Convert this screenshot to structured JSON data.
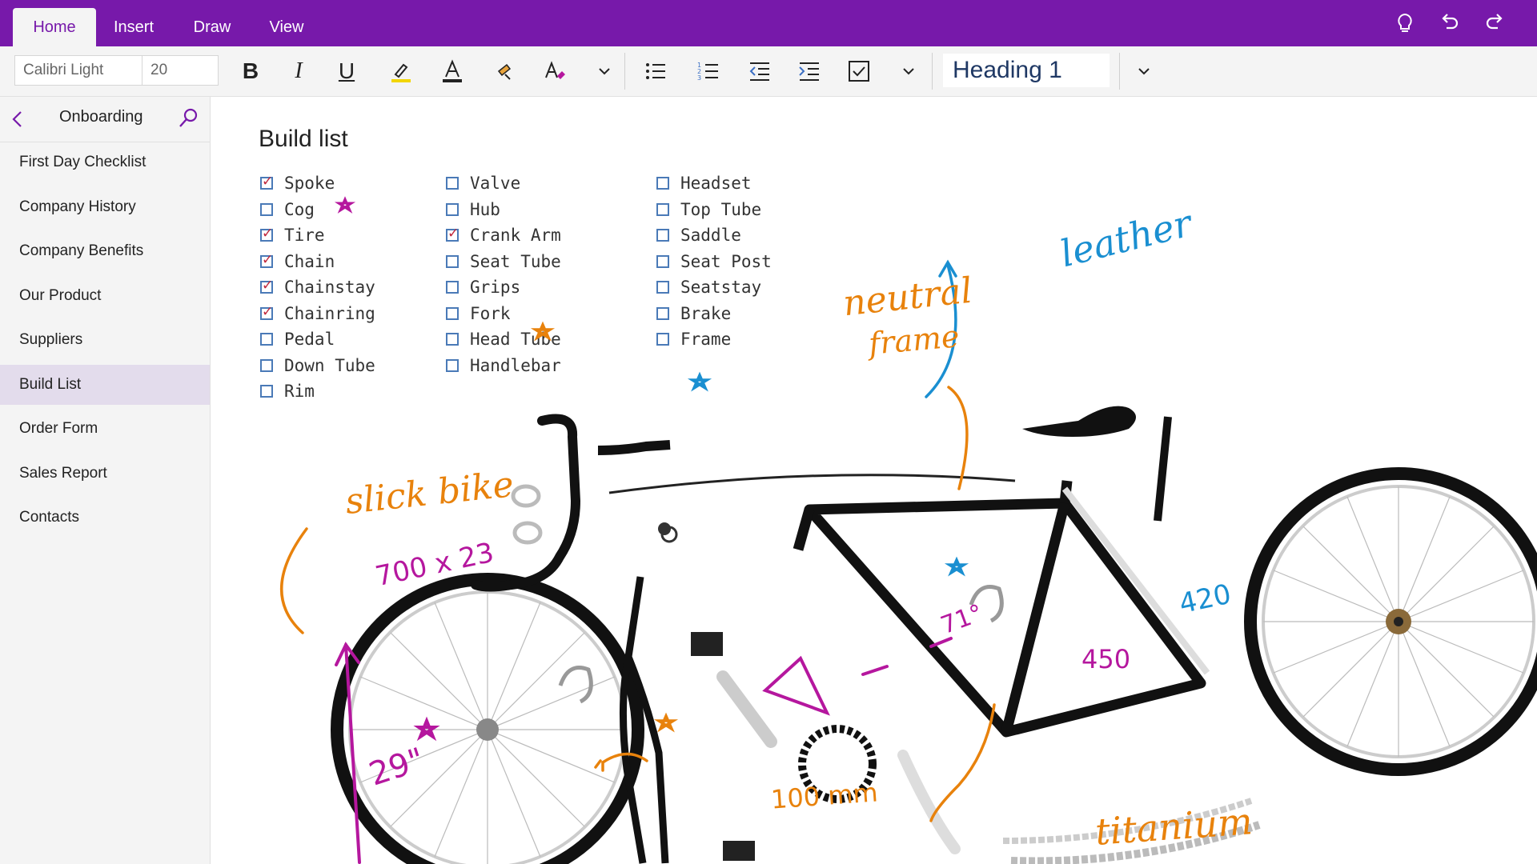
{
  "tabs": [
    {
      "label": "Home",
      "active": true
    },
    {
      "label": "Insert",
      "active": false
    },
    {
      "label": "Draw",
      "active": false
    },
    {
      "label": "View",
      "active": false
    }
  ],
  "title_icons": [
    "lightbulb-icon",
    "undo-icon",
    "redo-icon"
  ],
  "ribbon": {
    "font_name": "Calibri Light",
    "font_size": "20",
    "style": "Heading 1",
    "buttons": [
      "bold",
      "italic",
      "underline",
      "highlight",
      "font-color",
      "format-painter",
      "clear-formatting",
      "more",
      "bullets",
      "numbering",
      "outdent",
      "indent",
      "todo-tag",
      "more",
      "styles-dropdown"
    ]
  },
  "sidebar": {
    "section": "Onboarding",
    "pages": [
      {
        "label": "First Day Checklist",
        "selected": false
      },
      {
        "label": "Company History",
        "selected": false
      },
      {
        "label": "Company Benefits",
        "selected": false
      },
      {
        "label": "Our Product",
        "selected": false
      },
      {
        "label": "Suppliers",
        "selected": false
      },
      {
        "label": "Build List",
        "selected": true
      },
      {
        "label": "Order Form",
        "selected": false
      },
      {
        "label": "Sales Report",
        "selected": false
      },
      {
        "label": "Contacts",
        "selected": false
      }
    ]
  },
  "page": {
    "title": "Build list",
    "columns": [
      [
        {
          "label": "Spoke",
          "checked": true
        },
        {
          "label": "Cog",
          "checked": false
        },
        {
          "label": "Tire",
          "checked": true
        },
        {
          "label": "Chain",
          "checked": true
        },
        {
          "label": "Chainstay",
          "checked": true
        },
        {
          "label": "Chainring",
          "checked": true
        },
        {
          "label": "Pedal",
          "checked": false
        },
        {
          "label": "Down Tube",
          "checked": false
        },
        {
          "label": "Rim",
          "checked": false
        }
      ],
      [
        {
          "label": "Valve",
          "checked": false
        },
        {
          "label": "Hub",
          "checked": false
        },
        {
          "label": "Crank Arm",
          "checked": true
        },
        {
          "label": "Seat Tube",
          "checked": false
        },
        {
          "label": "Grips",
          "checked": false
        },
        {
          "label": "Fork",
          "checked": false
        },
        {
          "label": "Head Tube",
          "checked": false
        },
        {
          "label": "Handlebar",
          "checked": false
        }
      ],
      [
        {
          "label": "Headset",
          "checked": false
        },
        {
          "label": "Top Tube",
          "checked": false
        },
        {
          "label": "Saddle",
          "checked": false
        },
        {
          "label": "Seat Post",
          "checked": false
        },
        {
          "label": "Seatstay",
          "checked": false
        },
        {
          "label": "Brake",
          "checked": false
        },
        {
          "label": "Frame",
          "checked": false
        }
      ]
    ],
    "ink": {
      "slick_bike": "slick bike",
      "tire_size": "700 x 23",
      "wheel_size": "29\"",
      "neutral": "neutral",
      "frame": "frame",
      "leather": "leather",
      "angle": "71°",
      "top_len": "450",
      "stay_len": "420",
      "stem_len": "100 mm",
      "titanium": "titanium"
    },
    "ink_colors": {
      "purple": "#b5179e",
      "orange": "#e8820c",
      "blue": "#1a8fd1"
    }
  },
  "colors": {
    "accent": "#7719aa",
    "ribbon": "#f4f4f4",
    "selected_page": "#e3dcec"
  }
}
